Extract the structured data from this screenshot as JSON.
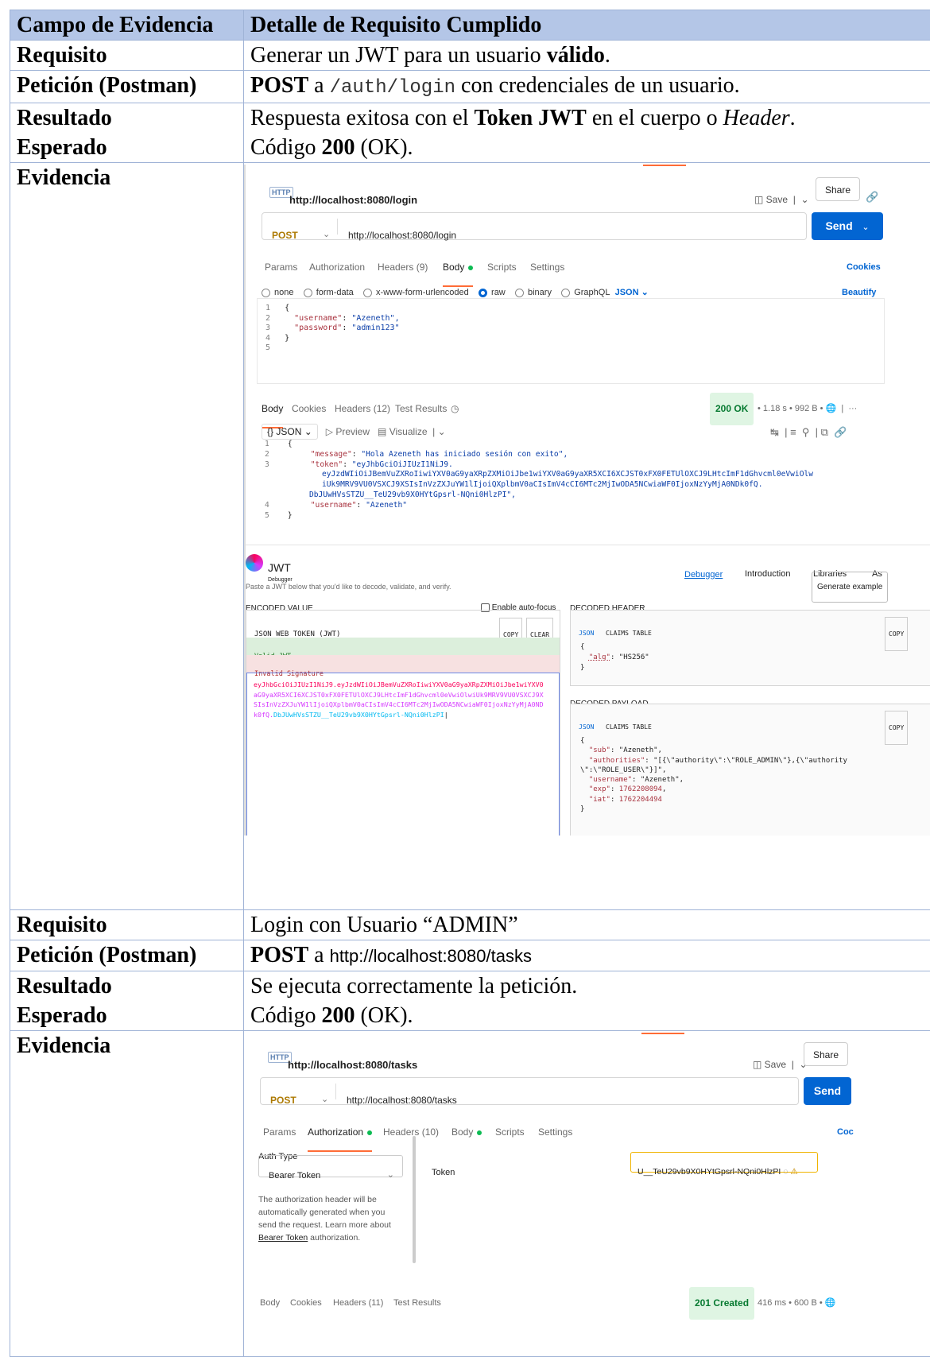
{
  "table": {
    "header_col1": "Campo de Evidencia",
    "header_col2": "Detalle de Requisito Cumplido"
  },
  "section1": {
    "req_label": "Requisito",
    "req_pre": "Generar un JWT para un usuario ",
    "req_bold": "válido",
    "req_post": ".",
    "pet_label": "Petición (Postman)",
    "pet_method": "POST",
    "pet_a": " a ",
    "pet_path": "/auth/login",
    "pet_post": " con credenciales de un usuario.",
    "res_label_1": "Resultado",
    "res_label_2": "Esperado",
    "res_pre": "Respuesta exitosa con el ",
    "res_bold": "Token JWT",
    "res_mid": " en el cuerpo o ",
    "res_italic": "Header",
    "res_post": ".",
    "code_pre": "Código ",
    "code_bold": "200",
    "code_post": " (OK).",
    "ev_label": "Evidencia"
  },
  "postman1": {
    "title": "http://localhost:8080/login",
    "save": "Save",
    "share": "Share",
    "method": "POST",
    "url": "http://localhost:8080/login",
    "send": "Send",
    "tabs": [
      "Params",
      "Authorization",
      "Headers (9)",
      "Body",
      "Scripts",
      "Settings"
    ],
    "cookies": "Cookies",
    "body_types": [
      "none",
      "form-data",
      "x-www-form-urlencoded",
      "raw",
      "binary",
      "GraphQL"
    ],
    "json": "JSON",
    "beautify": "Beautify",
    "req_lines": [
      "{",
      "\"username\": \"Azeneth\",",
      "\"password\": \"admin123\"",
      "}",
      ""
    ],
    "req_username_key": "\"username\"",
    "req_username_val": "\"Azeneth\",",
    "req_password_key": "\"password\"",
    "req_password_val": "\"admin123\"",
    "resp_tabs": [
      "Body",
      "Cookies",
      "Headers (12)",
      "Test Results"
    ],
    "status": "200 OK",
    "time": "1.18 s",
    "size": "992 B",
    "view_json": "{} JSON",
    "preview": "Preview",
    "visualize": "Visualize",
    "resp_message_key": "\"message\"",
    "resp_message_val": "\"Hola Azeneth has iniciado sesión con exito\",",
    "resp_token_key": "\"token\"",
    "resp_token_l1": "\"eyJhbGciOiJIUzI1NiJ9.",
    "resp_token_l2": "eyJzdWIiOiJBemVuZXRoIiwiYXV0aG9yaXRpZXMiOiJbe1wiYXV0aG9yaXR5XCI6XCJST0xFX0FETUlOXCJ9LHtcImF1dGhvcml0eVwiOlw",
    "resp_token_l3": "iUk9MRV9VU0VSXCJ9XSIsInVzZXJuYW1lIjoiQXplbmV0aCIsImV4cCI6MTc2MjIwODA5NCwiaWF0IjoxNzYyMjA0NDk0fQ.",
    "resp_token_l4": "DbJUwHVsSTZU__TeU29vb9X0HYtGpsrl-NQni0HlzPI\",",
    "resp_username_key": "\"username\"",
    "resp_username_val": "\"Azeneth\""
  },
  "jwt": {
    "logo": "JWT",
    "logo_sub": "Debugger",
    "nav": [
      "Debugger",
      "Introduction",
      "Libraries",
      "As"
    ],
    "hint": "Paste a JWT below that you'd like to decode, validate, and verify.",
    "generate": "Generate example",
    "encoded_value": "ENCODED VALUE",
    "auto_focus": "Enable auto-focus",
    "jwt_title": "JSON WEB TOKEN (JWT)",
    "copy": "COPY",
    "clear": "CLEAR",
    "valid": "Valid JWT",
    "invalid": "Invalid Signature",
    "enc_l1": "eyJhbGciOiJIUzI1NiJ9.eyJzdWIiOiJBemVuZXRoIiwiYXV0aG9yaXRpZXMiOiJbe1wiYXV0",
    "enc_l2": "aG9yaXR5XCI6XCJST0xFX0FETUlOXCJ9LHtcImF1dGhvcml0eVwiOlwiUk9MRV9VU0VSXCJ9X",
    "enc_l3": "SIsInVzZXJuYW1lIjoiQXplbmV0aCIsImV4cCI6MTc2MjIwODA5NCwiaWF0IjoxNzYyMjA0ND",
    "enc_l4a": "k0fQ.",
    "enc_l4b": "DbJUwHVsSTZU__TeU29vb9X0HYtGpsrl-NQni0HlzPI",
    "decoded_header": "DECODED HEADER",
    "decoded_payload": "DECODED PAYLOAD",
    "tab_json": "JSON",
    "tab_claims": "CLAIMS TABLE",
    "hdr_alg_key": "\"alg\"",
    "hdr_alg_val": "\"HS256\"",
    "pl_sub_key": "\"sub\"",
    "pl_sub_val": "\"Azeneth\",",
    "pl_auth_key": "\"authorities\"",
    "pl_auth_val1": "\"[{\\\"authority\\\":\\\"ROLE_ADMIN\\\"},{\\\"authority",
    "pl_auth_val2": "\\\":\\\"ROLE_USER\\\"}]\",",
    "pl_user_key": "\"username\"",
    "pl_user_val": "\"Azeneth\",",
    "pl_exp_key": "\"exp\"",
    "pl_exp_val": "1762208094",
    "pl_iat_key": "\"iat\"",
    "pl_iat_val": "1762204494"
  },
  "section2": {
    "req_label": "Requisito",
    "req_text": "Login con Usuario “ADMIN”",
    "pet_label": "Petición (Postman)",
    "pet_method": "POST",
    "pet_a": " a ",
    "pet_url": "http://localhost:8080/tasks",
    "res_label_1": "Resultado",
    "res_label_2": "Esperado",
    "res_text": "Se ejecuta correctamente la petición.",
    "code_pre": "Código ",
    "code_bold": "200",
    "code_post": " (OK).",
    "ev_label": "Evidencia"
  },
  "postman2": {
    "title": "http://localhost:8080/tasks",
    "save": "Save",
    "share": "Share",
    "method": "POST",
    "url": "http://localhost:8080/tasks",
    "send": "Send",
    "tabs": [
      "Params",
      "Authorization",
      "Headers (10)",
      "Body",
      "Scripts",
      "Settings"
    ],
    "cookies": "Coc",
    "auth_type_label": "Auth Type",
    "auth_type_value": "Bearer Token",
    "token_label": "Token",
    "token_value": "U__TeU29vb9X0HYtGpsrl-NQni0HlzPI",
    "auth_help_1": "The authorization header will be",
    "auth_help_2": "automatically generated when you",
    "auth_help_3": "send the request. Learn more about",
    "auth_help_link": "Bearer Token",
    "auth_help_4": " authorization.",
    "resp_tabs": [
      "Body",
      "Cookies",
      "Headers (11)",
      "Test Results"
    ],
    "status": "201 Created",
    "time": "416 ms",
    "size": "600 B"
  }
}
